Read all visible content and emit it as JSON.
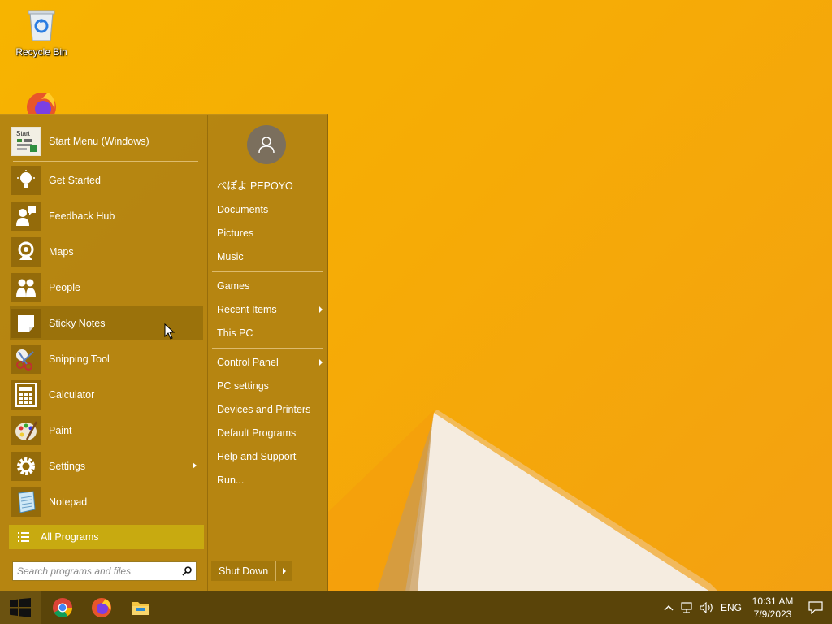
{
  "desktop": {
    "icons": [
      {
        "label": "Recycle Bin",
        "icon": "recycle-bin-icon"
      },
      {
        "label": "",
        "icon": "firefox-icon"
      }
    ]
  },
  "start_menu": {
    "pinned": {
      "label": "Start Menu (Windows)",
      "icon": "start-menu-settings-icon"
    },
    "apps": [
      {
        "label": "Get Started",
        "icon": "lightbulb-icon",
        "submenu": false
      },
      {
        "label": "Feedback Hub",
        "icon": "feedback-icon",
        "submenu": false
      },
      {
        "label": "Maps",
        "icon": "map-pin-icon",
        "submenu": false
      },
      {
        "label": "People",
        "icon": "people-icon",
        "submenu": false
      },
      {
        "label": "Sticky Notes",
        "icon": "sticky-note-icon",
        "submenu": false,
        "highlighted": true
      },
      {
        "label": "Snipping Tool",
        "icon": "scissors-icon",
        "submenu": false
      },
      {
        "label": "Calculator",
        "icon": "calculator-icon",
        "submenu": false
      },
      {
        "label": "Paint",
        "icon": "palette-icon",
        "submenu": false
      },
      {
        "label": "Settings",
        "icon": "gear-icon",
        "submenu": true
      },
      {
        "label": "Notepad",
        "icon": "notepad-icon",
        "submenu": false
      }
    ],
    "all_programs": "All Programs",
    "search_placeholder": "Search programs and files",
    "user": {
      "name": "ぺぽよ PEPOYO",
      "icon": "user-avatar-icon"
    },
    "right_items_group1": [
      "Documents",
      "Pictures",
      "Music"
    ],
    "right_items_group2": [
      {
        "label": "Games",
        "submenu": false
      },
      {
        "label": "Recent Items",
        "submenu": true
      },
      {
        "label": "This PC",
        "submenu": false
      }
    ],
    "right_items_group3": [
      {
        "label": "Control Panel",
        "submenu": true
      },
      {
        "label": "PC settings",
        "submenu": false
      },
      {
        "label": "Devices and Printers",
        "submenu": false
      },
      {
        "label": "Default Programs",
        "submenu": false
      },
      {
        "label": "Help and Support",
        "submenu": false
      },
      {
        "label": "Run...",
        "submenu": false
      }
    ],
    "shutdown_label": "Shut Down"
  },
  "taskbar": {
    "apps": [
      "chrome-icon",
      "firefox-icon",
      "file-explorer-icon"
    ],
    "tray": {
      "language": "ENG",
      "time": "10:31 AM",
      "date": "7/9/2023"
    }
  },
  "colors": {
    "wallpaper": "#f7b400",
    "start_menu_bg": "#b08212",
    "all_programs_bg": "#c8aa10",
    "taskbar_bg": "#5a4409"
  }
}
